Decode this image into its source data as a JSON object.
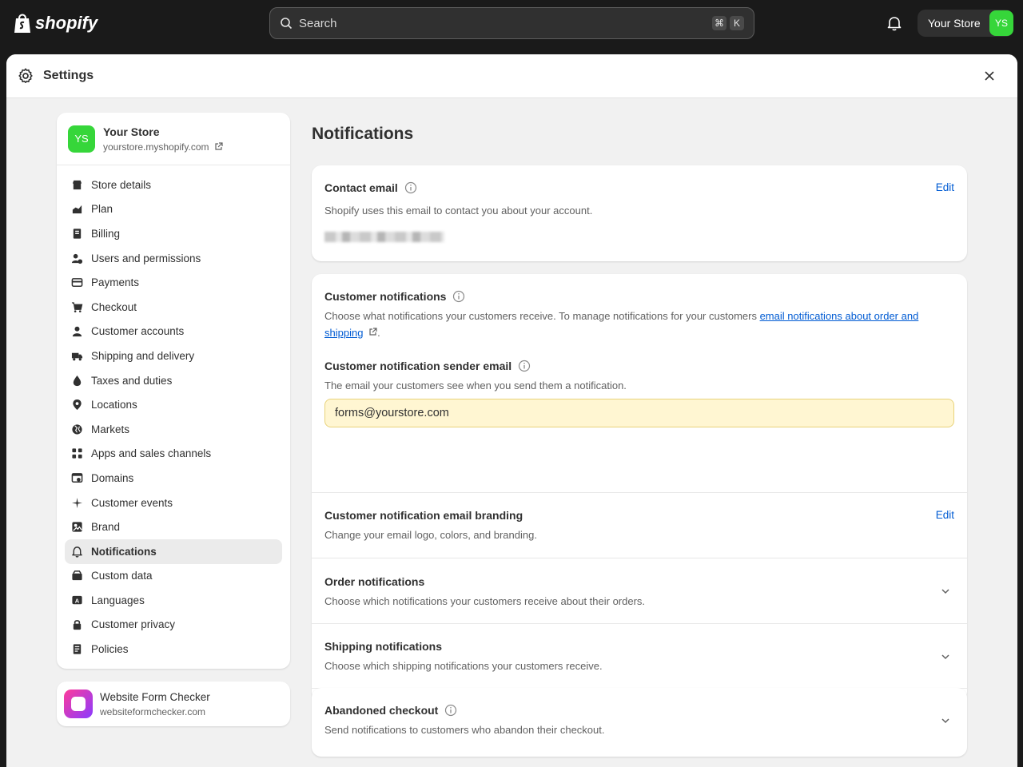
{
  "topbar": {
    "logo_text": "shopify",
    "search_placeholder": "Search",
    "shortcut_keys": [
      "⌘",
      "K"
    ],
    "store_label": "Your Store",
    "store_initials": "YS"
  },
  "modal": {
    "title": "Settings"
  },
  "sidebar": {
    "store": {
      "name": "Your Store",
      "url": "yourstore.myshopify.com",
      "initials": "YS"
    },
    "items": [
      {
        "label": "Store details",
        "icon": "store-icon"
      },
      {
        "label": "Plan",
        "icon": "plan-icon"
      },
      {
        "label": "Billing",
        "icon": "billing-icon"
      },
      {
        "label": "Users and permissions",
        "icon": "users-icon"
      },
      {
        "label": "Payments",
        "icon": "payments-icon"
      },
      {
        "label": "Checkout",
        "icon": "cart-icon"
      },
      {
        "label": "Customer accounts",
        "icon": "person-icon"
      },
      {
        "label": "Shipping and delivery",
        "icon": "truck-icon"
      },
      {
        "label": "Taxes and duties",
        "icon": "tax-icon"
      },
      {
        "label": "Locations",
        "icon": "location-icon"
      },
      {
        "label": "Markets",
        "icon": "globe-icon"
      },
      {
        "label": "Apps and sales channels",
        "icon": "apps-icon"
      },
      {
        "label": "Domains",
        "icon": "domain-icon"
      },
      {
        "label": "Customer events",
        "icon": "sparkle-icon"
      },
      {
        "label": "Brand",
        "icon": "brand-icon"
      },
      {
        "label": "Notifications",
        "icon": "bell-icon",
        "active": true
      },
      {
        "label": "Custom data",
        "icon": "database-icon"
      },
      {
        "label": "Languages",
        "icon": "language-icon"
      },
      {
        "label": "Customer privacy",
        "icon": "lock-icon"
      },
      {
        "label": "Policies",
        "icon": "policy-icon"
      }
    ],
    "app": {
      "name": "Website Form Checker",
      "url": "websiteformchecker.com"
    }
  },
  "main": {
    "title": "Notifications",
    "contact_email": {
      "title": "Contact email",
      "edit_label": "Edit",
      "description": "Shopify uses this email to contact you about your account."
    },
    "customer_notifications": {
      "title": "Customer notifications",
      "description_prefix": "Choose what notifications your customers receive. To manage notifications for your customers ",
      "link_text": "email notifications about order and shipping",
      "description_suffix": "."
    },
    "sender_email": {
      "title": "Customer notification sender email",
      "description": "The email your customers see when you send them a notification.",
      "value": "forms@yourstore.com"
    },
    "branding": {
      "title": "Customer notification email branding",
      "edit_label": "Edit",
      "description": "Change your email logo, colors, and branding."
    },
    "order_notifications": {
      "title": "Order notifications",
      "description": "Choose which notifications your customers receive about their orders."
    },
    "shipping_notifications": {
      "title": "Shipping notifications",
      "description": "Choose which shipping notifications your customers receive."
    },
    "abandoned_checkout": {
      "title": "Abandoned checkout",
      "description": "Send notifications to customers who abandon their checkout."
    }
  },
  "colors": {
    "topbar": "#1a1a1a",
    "accent_link": "#005bd3",
    "avatar_green": "#36d63a",
    "input_highlight": "#fff6d2"
  }
}
